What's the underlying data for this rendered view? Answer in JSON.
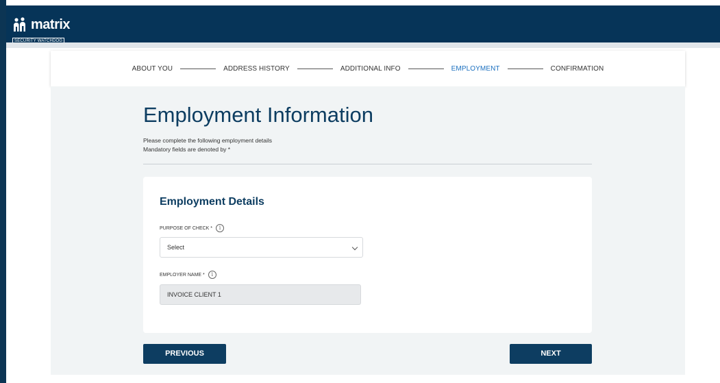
{
  "colors": {
    "header_bg": "#063458",
    "primary": "#0d3d61",
    "active_step": "#1a6fbf",
    "content_bg": "#f1f4f5"
  },
  "header": {
    "logo_icon": "people-icon",
    "brand": "matrix",
    "tagline": "SECURITY WATCHDOG"
  },
  "stepper": {
    "steps": [
      {
        "label": "ABOUT YOU",
        "active": false
      },
      {
        "label": "ADDRESS HISTORY",
        "active": false
      },
      {
        "label": "ADDITIONAL INFO",
        "active": false
      },
      {
        "label": "EMPLOYMENT",
        "active": true
      },
      {
        "label": "CONFIRMATION",
        "active": false
      }
    ]
  },
  "page": {
    "title": "Employment Information",
    "intro_line1": "Please complete the following employment details",
    "intro_line2": "Mandatory fields are denoted by *"
  },
  "card": {
    "title": "Employment Details",
    "purpose": {
      "label": "PURPOSE OF CHECK *",
      "info_icon": "info-icon",
      "value": "Select"
    },
    "employer": {
      "label": "EMPLOYER NAME *",
      "info_icon": "info-icon",
      "value": "INVOICE CLIENT 1"
    }
  },
  "buttons": {
    "previous": "PREVIOUS",
    "next": "NEXT"
  }
}
